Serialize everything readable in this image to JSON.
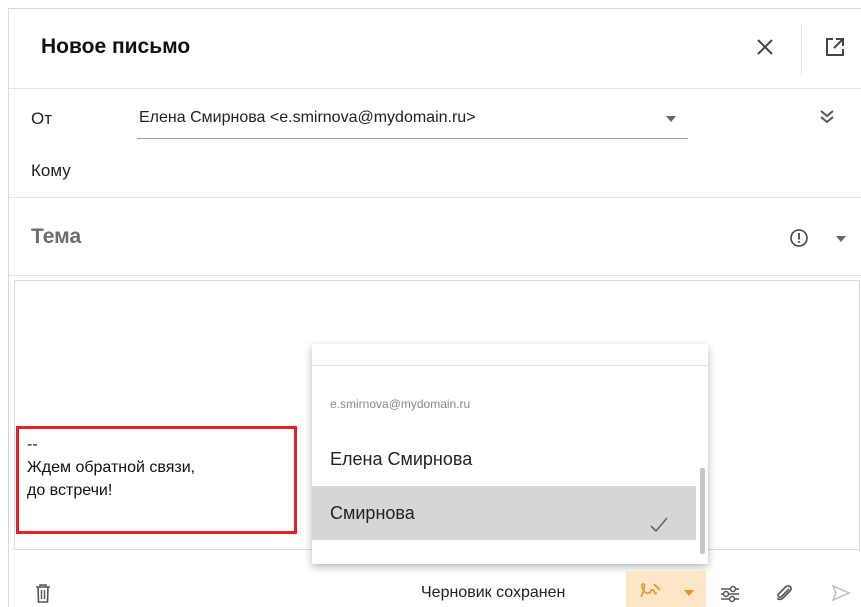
{
  "window": {
    "title": "Новое письмо"
  },
  "header": {
    "close_icon": "close-icon",
    "popout_icon": "popout-icon"
  },
  "from": {
    "label": "От",
    "value": "Елена Смирнова <e.smirnova@mydomain.ru>"
  },
  "to": {
    "label": "Кому"
  },
  "subject": {
    "placeholder": "Тема"
  },
  "editor": {
    "signature_lines": [
      "--",
      "Ждем обратной связи,",
      "до встречи!"
    ]
  },
  "signature_dropdown": {
    "group_label": "e.smirnova@mydomain.ru",
    "items": [
      {
        "label": "Елена Смирнова",
        "selected": false
      },
      {
        "label": "Смирнова",
        "selected": true
      }
    ]
  },
  "footer": {
    "draft_status": "Черновик сохранен"
  },
  "colors": {
    "signature_highlight": "#e02424",
    "signature_button_bg": "#fde7c6",
    "signature_button_accent": "#e8922a",
    "selected_item_bg": "#d6d6d6"
  }
}
